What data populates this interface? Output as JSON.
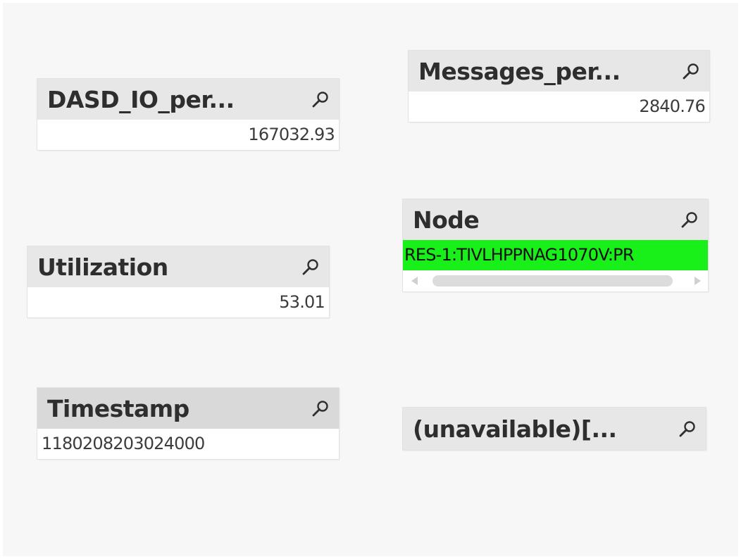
{
  "icons": {
    "search": "search-icon"
  },
  "colors": {
    "canvas_bg": "#f7f7f7",
    "caption_bg": "#e7e7e7",
    "caption_active_bg": "#d9d9d9",
    "selected_bg": "#19ef19"
  },
  "listboxes": {
    "dasd": {
      "title": "DASD_IO_per...",
      "value": "167032.93"
    },
    "messages": {
      "title": "Messages_per...",
      "value": "2840.76"
    },
    "utilization": {
      "title": "Utilization",
      "value": "53.01"
    },
    "node": {
      "title": "Node",
      "value": "RES-1:TIVLHPPNAG1070V:PR"
    },
    "timestamp": {
      "title": "Timestamp",
      "value": "1180208203024000"
    },
    "unavailable": {
      "title": "(unavailable)[..."
    }
  }
}
